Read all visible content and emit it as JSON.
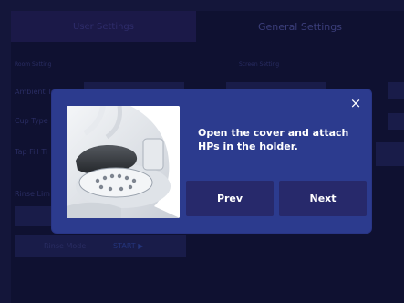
{
  "tabs": {
    "user_settings": "User Settings",
    "general_settings": "General Settings"
  },
  "background": {
    "left_section": "Room Setting",
    "right_section": "Screen Setting",
    "rows_left": [
      "Ambient Tem",
      "Cup Type",
      "Tap Fill Ti",
      "Rinse Lim"
    ],
    "rinse_mode_label": "Rinse Mode",
    "rinse_mode_value": "START ▶"
  },
  "modal": {
    "message": "Open the cover and attach HPs in the holder.",
    "prev_label": "Prev",
    "next_label": "Next",
    "close_icon": "×"
  },
  "colors": {
    "modal_bg": "#2c3b8e",
    "button_bg": "#27296b",
    "screen_bg": "#0f1131"
  }
}
